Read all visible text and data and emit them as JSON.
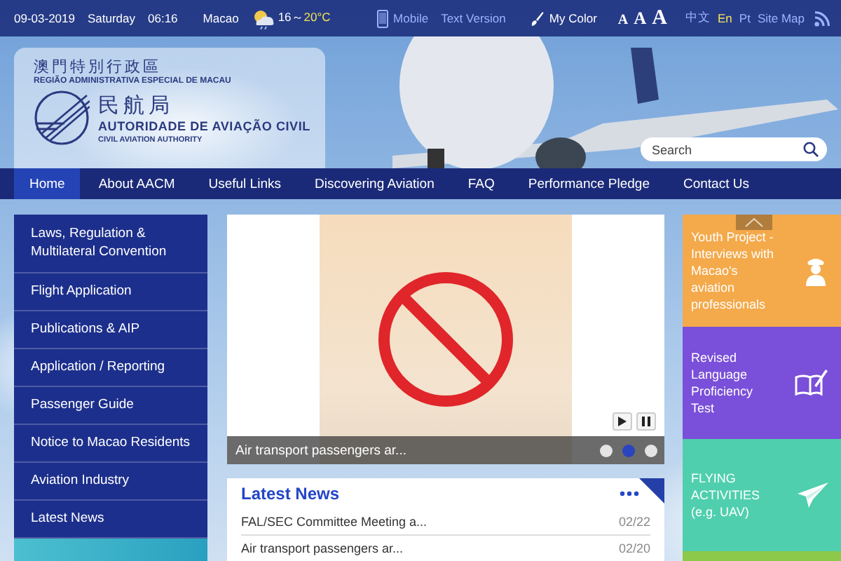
{
  "top_bar": {
    "date": "09-03-2019",
    "weekday": "Saturday",
    "time": "06:16",
    "city": "Macao",
    "temp_low": "16～",
    "temp_high": "20°C",
    "links": [
      {
        "label": "Mobile",
        "kind": "mobile"
      },
      {
        "label": "Text Version",
        "kind": "text"
      },
      {
        "label": "My Color",
        "kind": "color"
      }
    ],
    "font_sizes": [
      "A",
      "A",
      "A"
    ],
    "languages": [
      {
        "label": "中文",
        "selected": false
      },
      {
        "label": "En",
        "selected": true
      },
      {
        "label": "Pt",
        "selected": false
      }
    ],
    "site_map": "Site Map"
  },
  "header": {
    "region_zh": "澳門特別行政區",
    "region_pt": "REGIÃO ADMINISTRATIVA ESPECIAL DE MACAU",
    "authority_zh": "民航局",
    "authority_pt": "AUTORIDADE DE AVIAÇÃO CIVIL",
    "authority_en": "CIVIL AVIATION AUTHORITY",
    "search": {
      "placeholder": "Search"
    }
  },
  "nav": [
    {
      "label": "Home",
      "selected": true
    },
    {
      "label": "About AACM",
      "selected": false
    },
    {
      "label": "Useful Links",
      "selected": false
    },
    {
      "label": "Discovering Aviation",
      "selected": false
    },
    {
      "label": "FAQ",
      "selected": false
    },
    {
      "label": "Performance Pledge",
      "selected": false
    },
    {
      "label": "Contact Us",
      "selected": false
    }
  ],
  "sidebar": {
    "items": [
      "Laws, Regulation & Multilateral Convention",
      "Flight Application",
      "Publications & AIP",
      "Application / Reporting",
      "Passenger Guide",
      "Notice to Macao Residents",
      "Aviation Industry",
      "Latest News"
    ]
  },
  "slideshow": {
    "caption": "Air transport passengers ar...",
    "slides": [
      {
        "selected": false
      },
      {
        "selected": true
      },
      {
        "selected": false
      }
    ]
  },
  "news": {
    "title": "Latest News",
    "items": [
      {
        "title": "FAL/SEC Committee Meeting a...",
        "date": "02/22"
      },
      {
        "title": "Air transport passengers ar...",
        "date": "02/20"
      }
    ]
  },
  "promos": [
    {
      "label": "Youth Project - Interviews with Macao's aviation professionals",
      "kind": "youth"
    },
    {
      "label": "Revised Language Proficiency Test",
      "kind": "language"
    },
    {
      "label": "FLYING ACTIVITIES (e.g. UAV)",
      "kind": "flying"
    },
    {
      "kind": "more"
    }
  ]
}
